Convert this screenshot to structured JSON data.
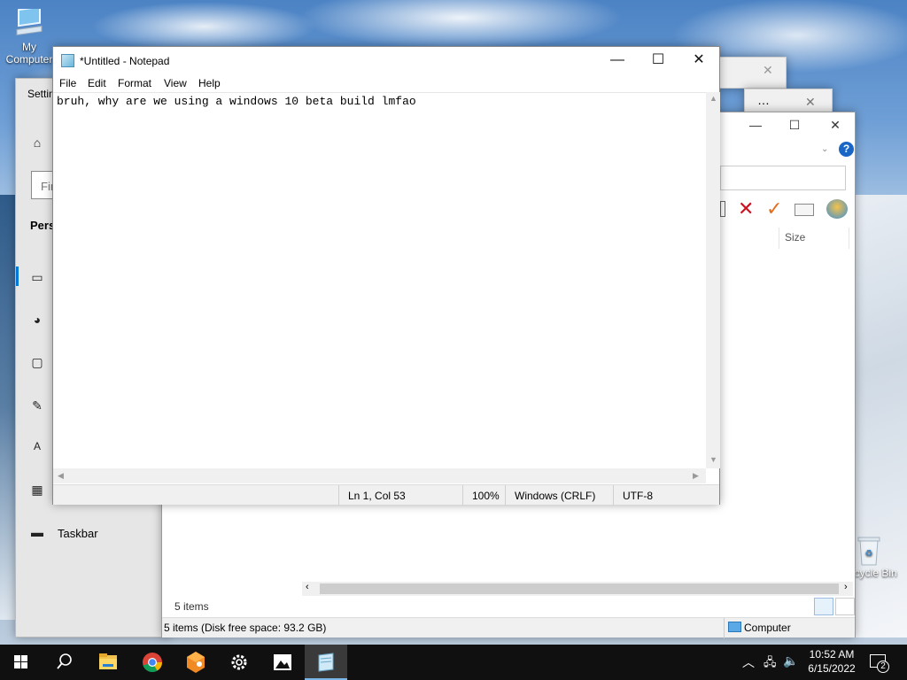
{
  "desktop": {
    "icons": [
      {
        "label": "My Computer"
      },
      {
        "label": "Recycle Bin"
      }
    ]
  },
  "settings": {
    "title": "Settings",
    "search_placeholder": "Find a setting",
    "section": "Personalization",
    "nav": [
      {
        "icon": "home-icon"
      },
      {
        "icon": "background-icon"
      },
      {
        "icon": "colors-icon"
      },
      {
        "icon": "lock-screen-icon"
      },
      {
        "icon": "themes-icon"
      },
      {
        "icon": "fonts-icon"
      },
      {
        "icon": "start-icon"
      },
      {
        "icon": "taskbar-icon",
        "label": "Taskbar"
      }
    ]
  },
  "explorer": {
    "column_size": "Size",
    "items_count": "5 items",
    "status_left": "5 items (Disk free space: 93.2 GB)",
    "status_right": "Computer"
  },
  "notepad": {
    "title": "*Untitled - Notepad",
    "menu": [
      "File",
      "Edit",
      "Format",
      "View",
      "Help"
    ],
    "text": "bruh, why are we using a windows 10 beta build lmfao",
    "status": {
      "position": "Ln 1, Col 53",
      "zoom": "100%",
      "line_endings": "Windows (CRLF)",
      "encoding": "UTF-8"
    }
  },
  "taskbar": {
    "apps": [
      {
        "name": "search"
      },
      {
        "name": "file-explorer"
      },
      {
        "name": "chrome"
      },
      {
        "name": "app-orange"
      },
      {
        "name": "settings"
      },
      {
        "name": "photos"
      },
      {
        "name": "notepad",
        "active": true
      }
    ],
    "time": "10:52 AM",
    "date": "6/15/2022",
    "notification_count": "2"
  }
}
